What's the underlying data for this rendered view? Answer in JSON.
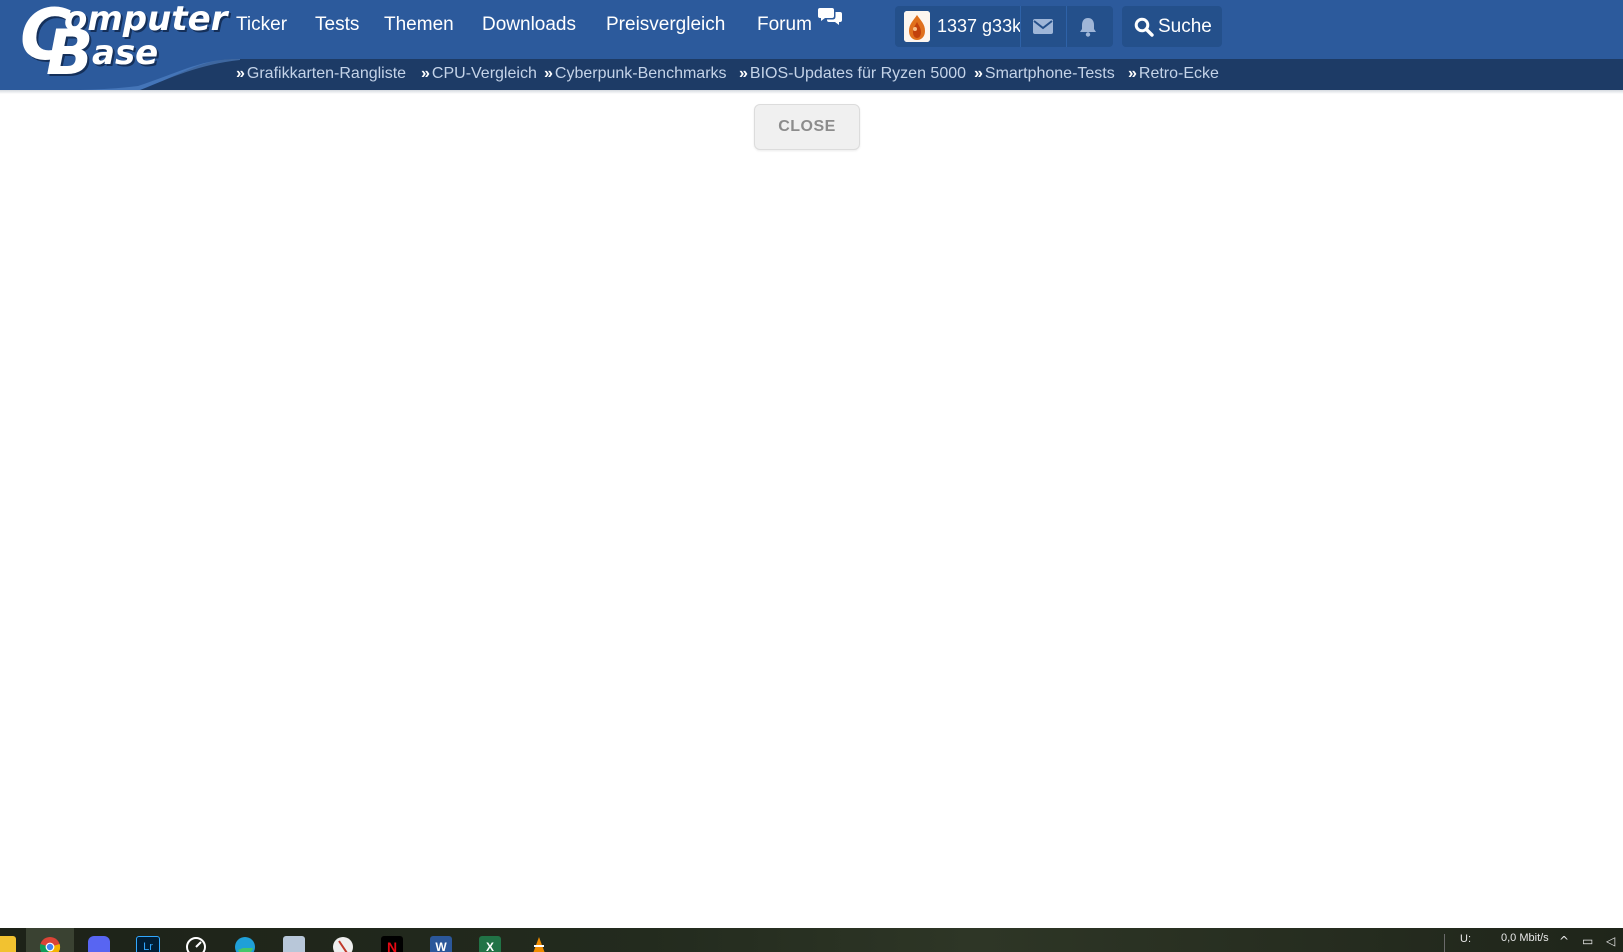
{
  "logo": {
    "alt": "ComputerBase",
    "c": "C",
    "omputer": "omputer",
    "b": "B",
    "ase": "ase"
  },
  "nav": {
    "items": [
      {
        "label": "Ticker"
      },
      {
        "label": "Tests"
      },
      {
        "label": "Themen"
      },
      {
        "label": "Downloads"
      },
      {
        "label": "Preisvergleich"
      },
      {
        "label": "Forum"
      }
    ]
  },
  "user": {
    "name": "1337 g33k"
  },
  "search": {
    "label": "Suche"
  },
  "quick_links": {
    "arrow": "»",
    "items": [
      {
        "label": "Grafikkarten-Rangliste"
      },
      {
        "label": "CPU-Vergleich"
      },
      {
        "label": "Cyberpunk-Benchmarks"
      },
      {
        "label": "BIOS-Updates für Ryzen 5000"
      },
      {
        "label": "Smartphone-Tests"
      },
      {
        "label": "Retro-Ecke"
      }
    ]
  },
  "close_button": {
    "label": "CLOSE"
  },
  "taskbar": {
    "apps": [
      {
        "icon": "file-explorer-icon"
      },
      {
        "icon": "chrome-icon"
      },
      {
        "icon": "discord-icon"
      },
      {
        "icon": "lightroom-icon",
        "text": "Lr"
      },
      {
        "icon": "speedometer-app-icon"
      },
      {
        "icon": "edge-icon"
      },
      {
        "icon": "photos-icon"
      },
      {
        "icon": "compass-app-icon"
      },
      {
        "icon": "netflix-icon",
        "text": "N"
      },
      {
        "icon": "word-icon",
        "text": "W"
      },
      {
        "icon": "excel-icon",
        "text": "X"
      },
      {
        "icon": "vlc-icon"
      }
    ],
    "tray": {
      "upload_label": "U:",
      "speed": "0,0 Mbit/s"
    }
  },
  "colors": {
    "header": "#2c5a9c",
    "subbar": "#1d3b66",
    "user_box": "#24508b",
    "quick_link_text": "#c4d3e8"
  }
}
